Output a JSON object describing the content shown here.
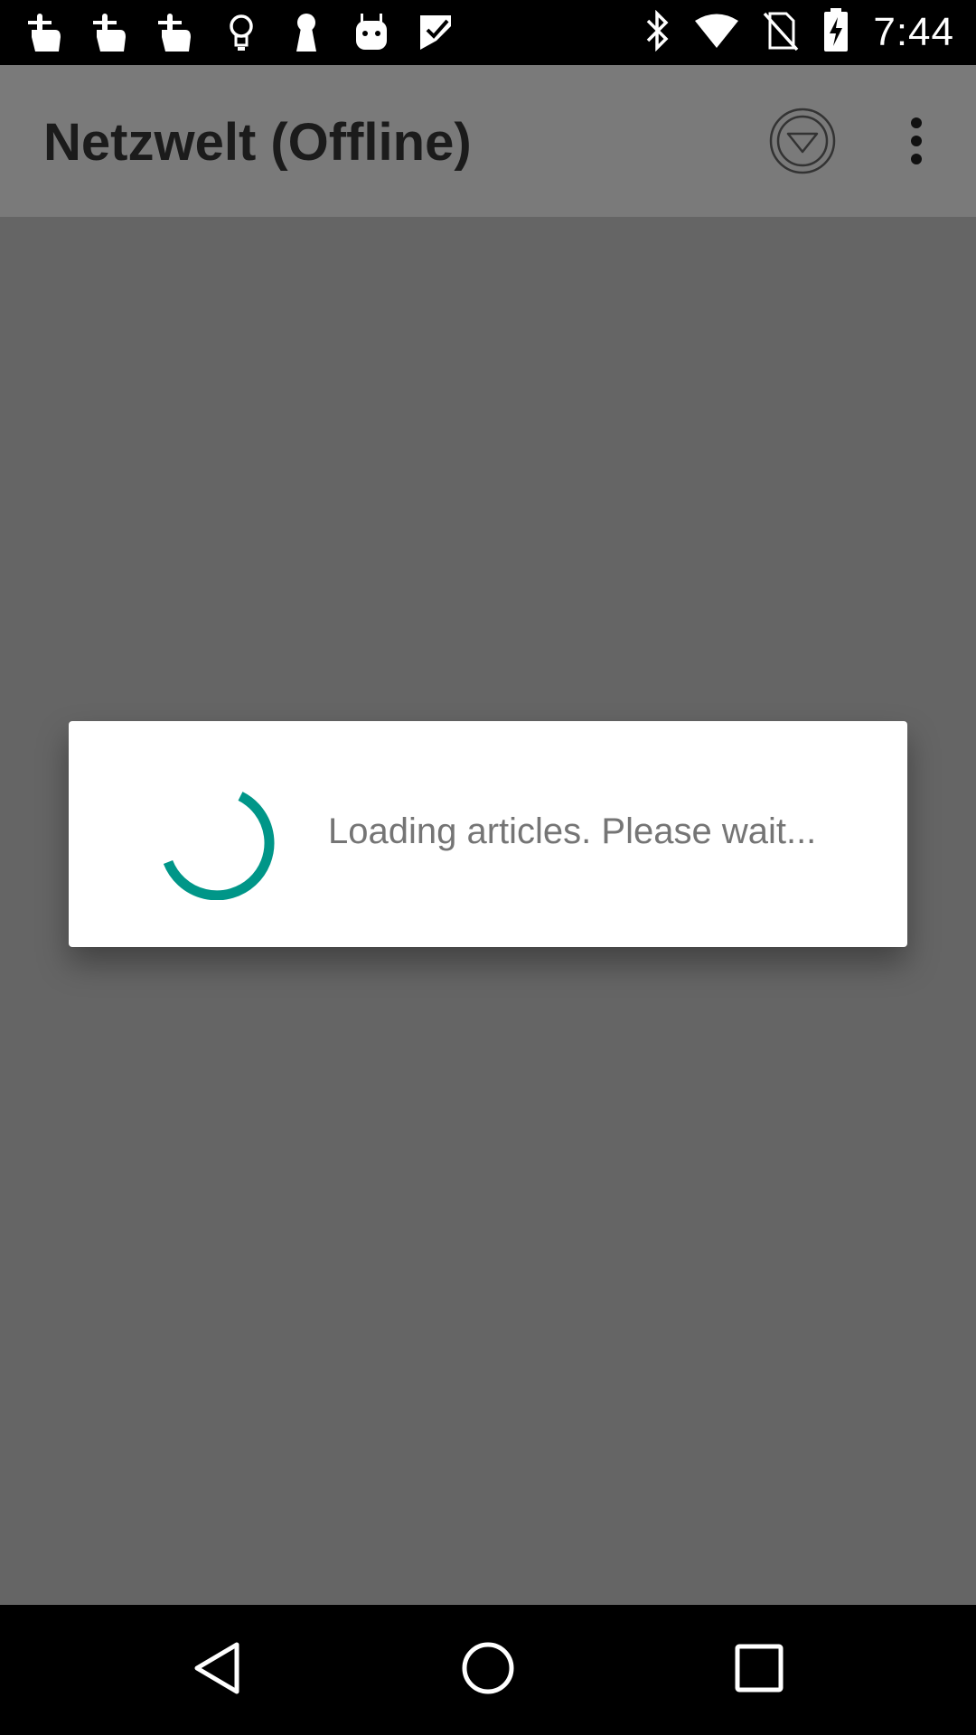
{
  "status_bar": {
    "time": "7:44",
    "left_icons": [
      "tap-gesture-icon",
      "tap-gesture-icon",
      "tap-gesture-icon",
      "lightbulb-icon",
      "keyhole-icon",
      "android-robot-icon",
      "task-check-icon"
    ],
    "right_icons": [
      "bluetooth-icon",
      "wifi-icon",
      "no-sim-icon",
      "battery-charging-icon"
    ]
  },
  "app_bar": {
    "title": "Netzwelt (Offline)",
    "actions": [
      "download-circle-icon",
      "overflow-menu-icon"
    ]
  },
  "dialog": {
    "message": "Loading articles. Please wait...",
    "spinner_color": "#009688"
  },
  "nav_bar": {
    "buttons": [
      "back-icon",
      "home-icon",
      "recents-icon"
    ]
  },
  "colors": {
    "scrim": "#656565",
    "app_bar": "#7a7a7a",
    "accent": "#009688"
  }
}
